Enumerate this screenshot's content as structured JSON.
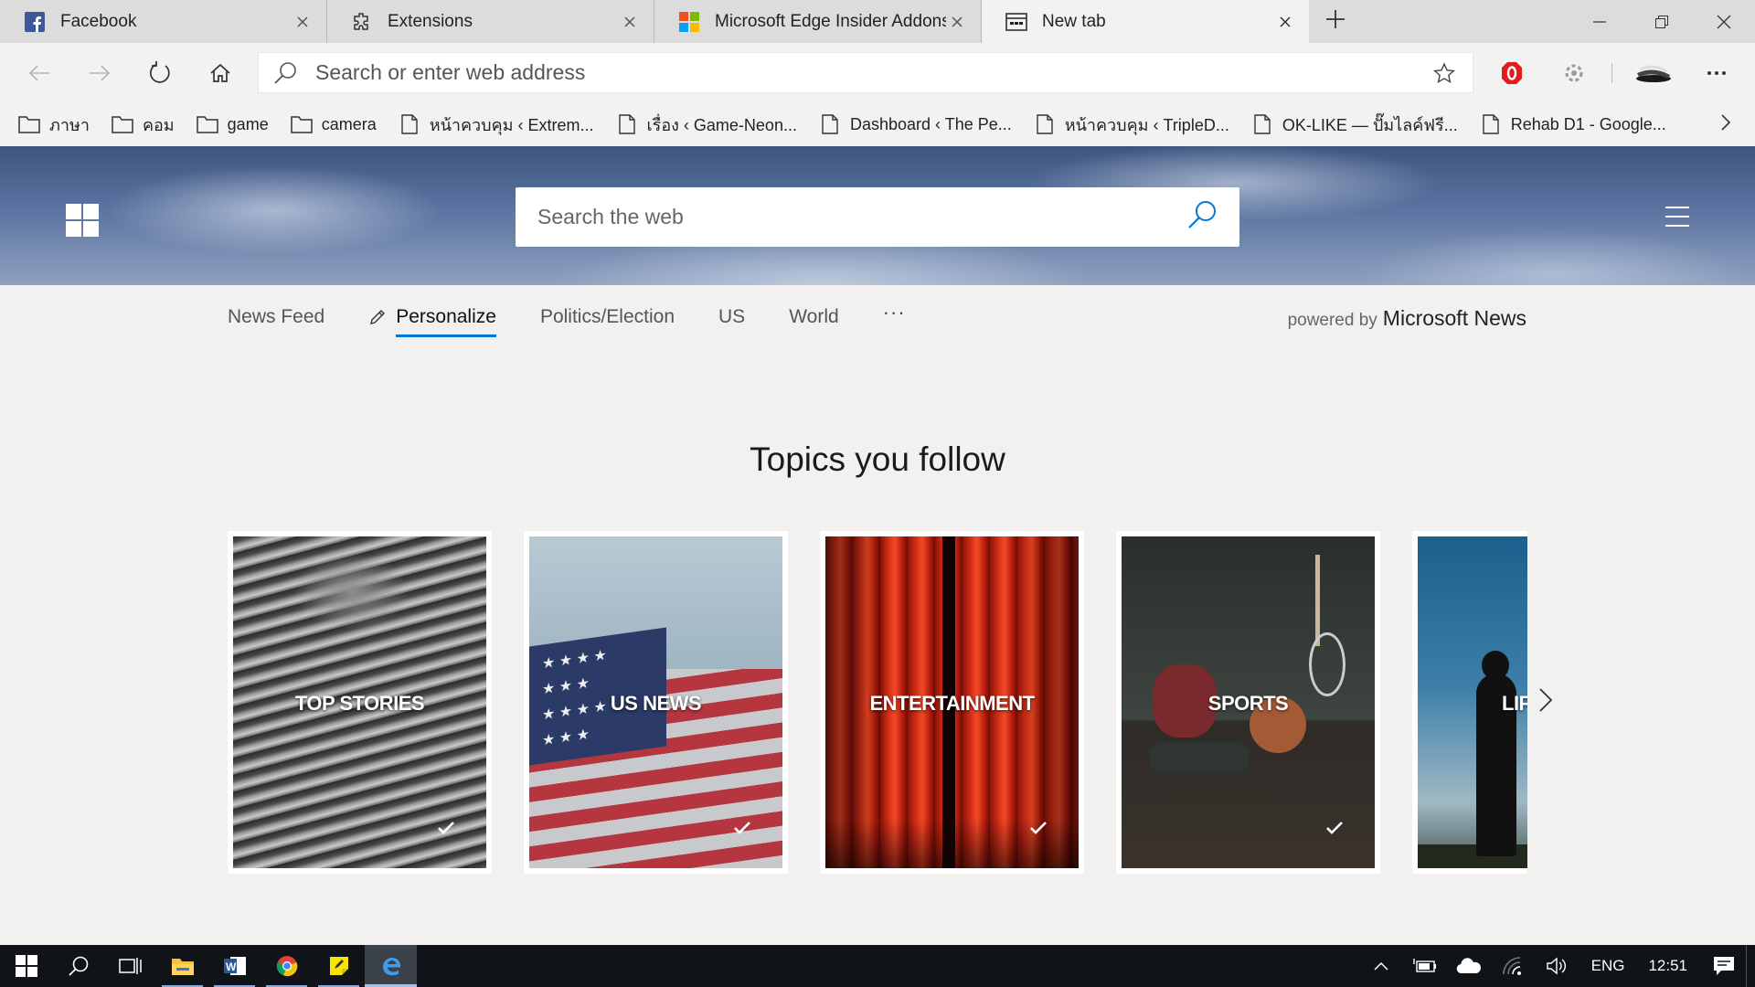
{
  "tabs": [
    {
      "label": "Facebook",
      "icon": "facebook-icon",
      "active": false
    },
    {
      "label": "Extensions",
      "icon": "puzzle-icon",
      "active": false
    },
    {
      "label": "Microsoft Edge Insider Addons",
      "icon": "microsoft-logo-icon",
      "active": false
    },
    {
      "label": "New tab",
      "icon": "newtab-page-icon",
      "active": true
    }
  ],
  "address_bar": {
    "placeholder": "Search or enter web address",
    "value": ""
  },
  "favorites": [
    {
      "label": "ภาษา",
      "type": "folder"
    },
    {
      "label": "คอม",
      "type": "folder"
    },
    {
      "label": "game",
      "type": "folder"
    },
    {
      "label": "camera",
      "type": "folder"
    },
    {
      "label": "หน้าควบคุม ‹ Extrem...",
      "type": "page"
    },
    {
      "label": "เรื่อง ‹ Game-Neon...",
      "type": "page"
    },
    {
      "label": "Dashboard ‹ The Pe...",
      "type": "page"
    },
    {
      "label": "หน้าควบคุม ‹ TripleD...",
      "type": "page"
    },
    {
      "label": "OK-LIKE — ปั๊มไลค์ฟรี...",
      "type": "page"
    },
    {
      "label": "Rehab D1 - Google...",
      "type": "page"
    }
  ],
  "hero": {
    "search_placeholder": "Search the web"
  },
  "feed_nav": {
    "items": [
      {
        "label": "News Feed",
        "active": false
      },
      {
        "label": "Personalize",
        "active": true
      },
      {
        "label": "Politics/Election",
        "active": false
      },
      {
        "label": "US",
        "active": false
      },
      {
        "label": "World",
        "active": false
      }
    ],
    "more": "···",
    "powered_prefix": "powered by",
    "powered_brand": "Microsoft News"
  },
  "topics": {
    "title": "Topics you follow",
    "cards": [
      {
        "label": "TOP STORIES",
        "followed": true
      },
      {
        "label": "US NEWS",
        "followed": true
      },
      {
        "label": "ENTERTAINMENT",
        "followed": true
      },
      {
        "label": "SPORTS",
        "followed": true
      },
      {
        "label": "LIFESTYLE",
        "followed": false
      }
    ]
  },
  "taskbar": {
    "language": "ENG",
    "time": "12:51"
  },
  "colors": {
    "accent": "#0078d7",
    "taskbar": "#101418",
    "tabstrip": "#dcdcdc",
    "page_bg": "#f2f1f0"
  }
}
